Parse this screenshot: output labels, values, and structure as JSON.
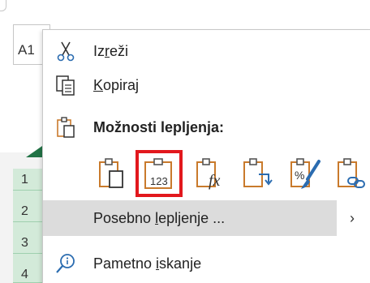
{
  "background": {
    "name_box_text": "A1",
    "row_headers": [
      "1",
      "2",
      "3",
      "4"
    ]
  },
  "context_menu": {
    "cut": {
      "label_pre": "Iz",
      "label_u": "r",
      "label_post": "eži",
      "icon": "scissors-icon"
    },
    "copy": {
      "label_pre": "",
      "label_u": "K",
      "label_post": "opiraj",
      "icon": "copy-icon"
    },
    "paste_options": {
      "label": "Možnosti lepljenja:",
      "icon": "clipboard-icon",
      "buttons": [
        {
          "name": "paste-default",
          "icon": "clipboard-paste-icon"
        },
        {
          "name": "paste-values",
          "icon": "clipboard-values-icon",
          "text": "123",
          "selected": true
        },
        {
          "name": "paste-formulas",
          "icon": "clipboard-formulas-icon",
          "text": "fx"
        },
        {
          "name": "paste-transpose",
          "icon": "clipboard-transpose-icon"
        },
        {
          "name": "paste-formatting",
          "icon": "clipboard-formatting-icon",
          "text": "%"
        },
        {
          "name": "paste-link",
          "icon": "clipboard-link-icon"
        }
      ]
    },
    "paste_special": {
      "label_pre": "Posebno ",
      "label_u": "l",
      "label_post": "epljenje ...",
      "submenu_arrow": "›"
    },
    "smart_lookup": {
      "label_pre": "Pametno ",
      "label_u": "i",
      "label_post": "skanje",
      "icon": "lookup-icon"
    }
  },
  "colors": {
    "accent_green": "#217346",
    "clipboard_orange": "#c97a2c",
    "highlight_red": "#e2181d",
    "menu_hover": "#dcdcdc"
  }
}
